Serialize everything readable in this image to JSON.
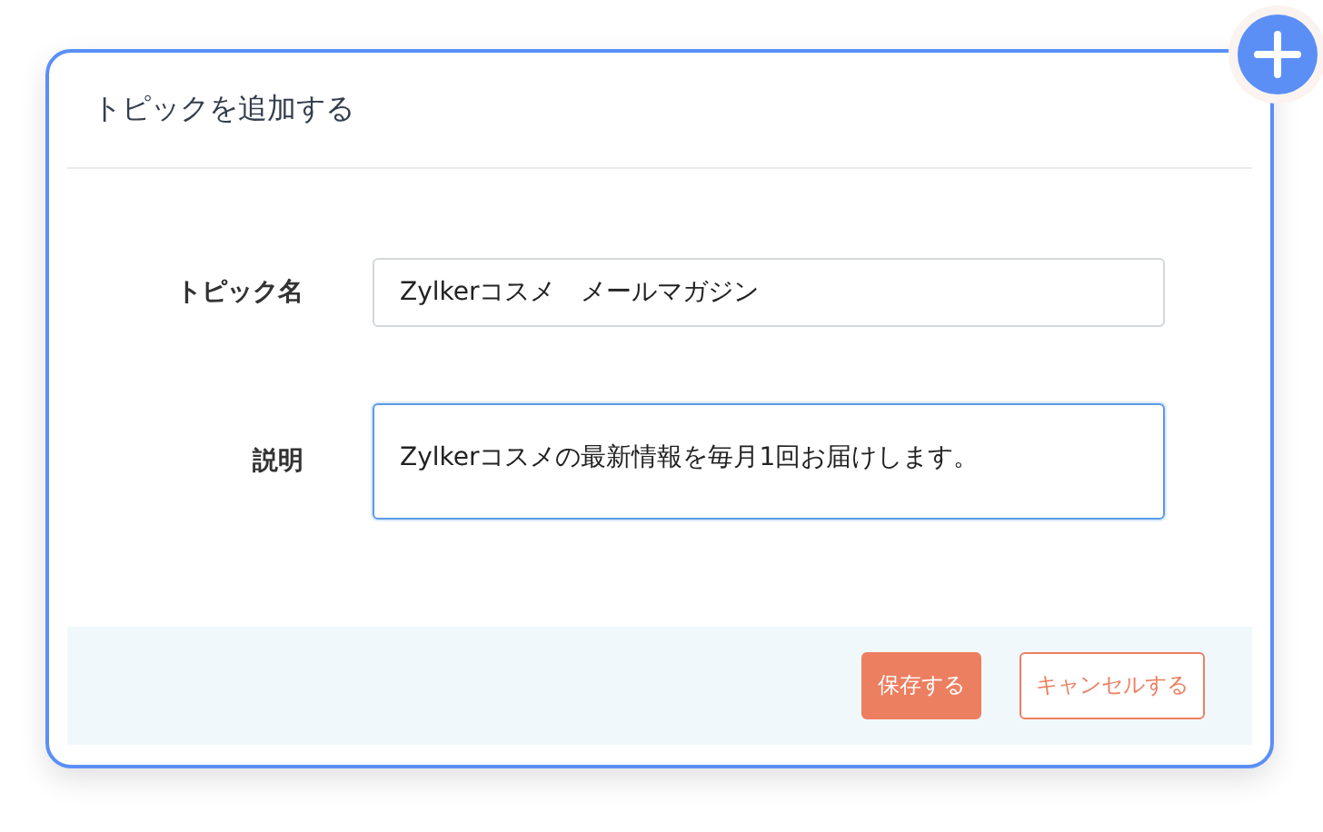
{
  "dialog": {
    "title": "トピックを追加する"
  },
  "fields": [
    {
      "label": "トピック名",
      "kind": "input",
      "value": "Zylkerコスメ　メールマガジン",
      "focused": false
    },
    {
      "label": "説明",
      "kind": "textarea",
      "value": "Zylkerコスメの最新情報を毎月1回お届けします。",
      "focused": true
    }
  ],
  "buttons": [
    {
      "label": "保存する",
      "kind": "primary"
    },
    {
      "label": "キャンセルする",
      "kind": "secondary"
    }
  ]
}
